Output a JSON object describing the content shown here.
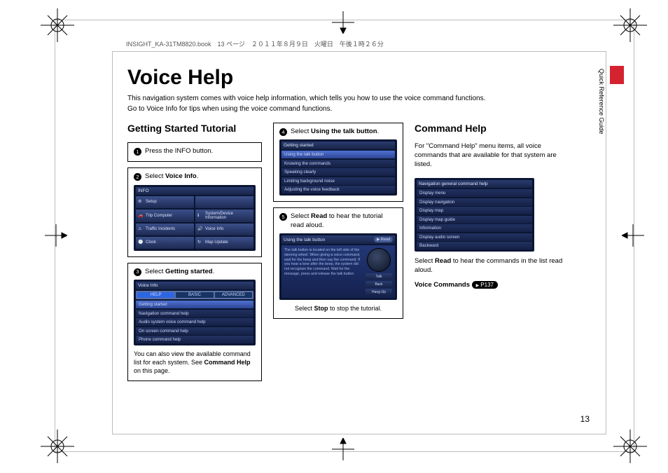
{
  "header": "INSIGHT_KA-31TM8820.book　13 ページ　２０１１年８月９日　火曜日　午後１時２６分",
  "title": "Voice Help",
  "intro_line1": "This navigation system comes with voice help information, which tells you how to use the voice command functions.",
  "intro_line2": "Go to Voice Info for tips when using the voice command functions.",
  "side_tab": "Quick Reference Guide",
  "page_number": "13",
  "left": {
    "heading": "Getting Started Tutorial",
    "step1": "Press the INFO button.",
    "step2_pre": "Select ",
    "step2_bold": "Voice Info",
    "step2_post": ".",
    "info_header": "INFO",
    "info_buttons": [
      "Setup",
      "Trip Computer",
      "System/Device Information",
      "Traffic Incidents",
      "Voice Info",
      "Clock",
      "Map Update"
    ],
    "step3_pre": "Select ",
    "step3_bold": "Getting started",
    "step3_post": ".",
    "voice_info_header": "Voice Info",
    "tabs": [
      "HELP",
      "BASIC",
      "ADVANCED"
    ],
    "voice_rows": [
      "Getting started",
      "Navigation command help",
      "Audio system voice command help",
      "On screen command help",
      "Phone command help"
    ],
    "footnote_pre": "You can also view the available command list for each system. See ",
    "footnote_bold": "Command Help",
    "footnote_post": " on this page."
  },
  "mid": {
    "step4_pre": "Select ",
    "step4_bold": "Using the talk button",
    "step4_post": ".",
    "gs_header": "Getting started",
    "gs_rows": [
      "Using the talk button",
      "Knowing the commands",
      "Speaking clearly",
      "Limiting background noise",
      "Adjusting the voice feedback"
    ],
    "step5_pre": "Select ",
    "step5_bold": "Read",
    "step5_mid": " to hear the tutorial read aloud.",
    "talk_header": "Using the talk button",
    "read_btn": "▶ Read",
    "talk_body": "The talk button is located on the left side of the steering wheel. When giving a voice command, wait for the beep and then say the command. If you hear a tone after the beep, the system did not recognize the command. Wait for the message, press and release the talk button.",
    "side_buttons": [
      "Talk",
      "Back",
      "Hang-Up"
    ],
    "stop_pre": "Select ",
    "stop_bold": "Stop",
    "stop_post": " to stop the tutorial."
  },
  "right": {
    "heading": "Command Help",
    "intro": "For \"Command Help\" menu items, all voice commands that are available for that system are listed.",
    "nav_header": "Navigation general command help",
    "nav_rows": [
      "Display menu",
      "Display navigation",
      "Display map",
      "Display map guide",
      "Information",
      "Display audio screen",
      "Backward"
    ],
    "read_pre": "Select ",
    "read_bold": "Read",
    "read_post": " to hear the commands in the list read aloud.",
    "vc_label": "Voice Commands",
    "page_ref": "P137"
  }
}
